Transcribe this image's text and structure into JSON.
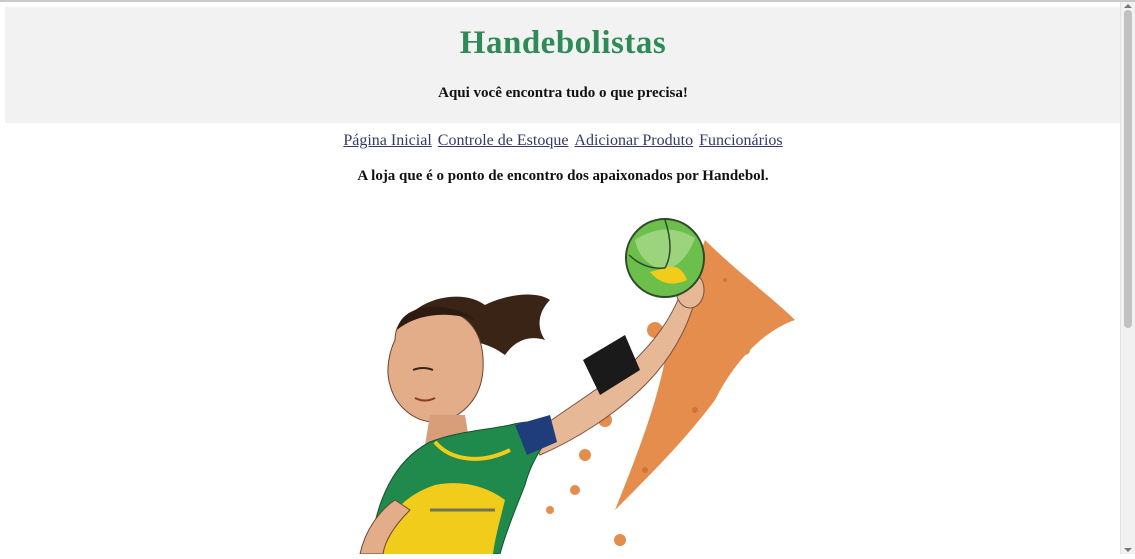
{
  "header": {
    "title": "Handebolistas",
    "tagline": "Aqui você encontra tudo o que precisa!"
  },
  "nav": {
    "items": [
      {
        "label": "Página Inicial"
      },
      {
        "label": "Controle de Estoque"
      },
      {
        "label": "Adicionar Produto"
      },
      {
        "label": "Funcionários"
      }
    ]
  },
  "main": {
    "intro": "A loja que é o ponto de encontro dos apaixonados por Handebol."
  },
  "hero_image": {
    "icon": "handball-player-illustration",
    "colors": {
      "jersey_green": "#1f8a4c",
      "jersey_yellow": "#f2cc1a",
      "splash_orange": "#e07a2e",
      "ball_green": "#6bbf4a",
      "title_green": "#2e8b57"
    }
  }
}
